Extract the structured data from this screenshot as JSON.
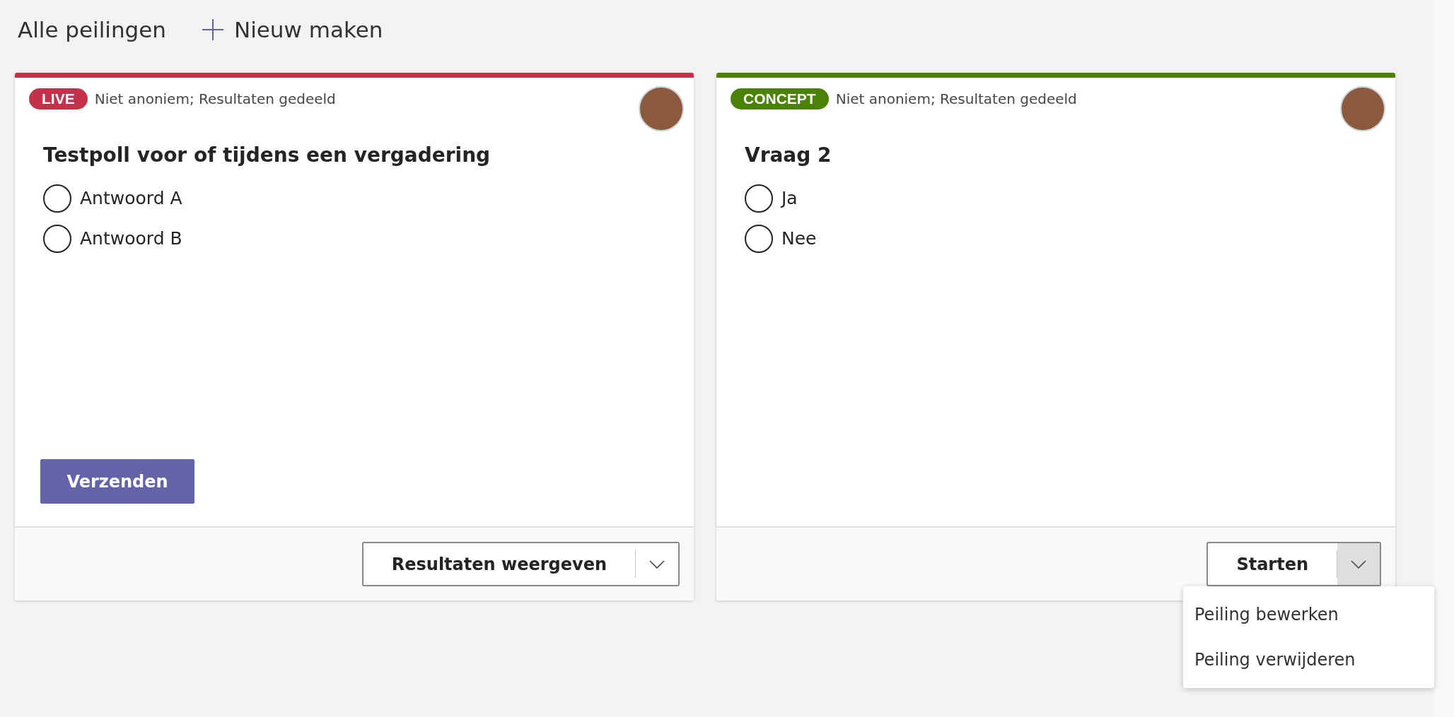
{
  "header": {
    "title": "Alle peilingen",
    "new_button": "Nieuw maken"
  },
  "polls": [
    {
      "status": "LIVE",
      "color": "#c4314b",
      "settings": "Niet anoniem; Resultaten gedeeld",
      "question": "Testpoll voor of tijdens een vergadering",
      "options": [
        "Antwoord A",
        "Antwoord B"
      ],
      "send_button": "Verzenden",
      "footer_button": {
        "label": "Resultaten weergeven",
        "expanded": false
      }
    },
    {
      "status": "CONCEPT",
      "color": "#498205",
      "settings": "Niet anoniem; Resultaten gedeeld",
      "question": "Vraag 2",
      "options": [
        "Ja",
        "Nee"
      ],
      "footer_button": {
        "label": "Starten",
        "expanded": true
      }
    }
  ],
  "menu": {
    "items": [
      "Peiling bewerken",
      "Peiling verwijderen"
    ]
  }
}
